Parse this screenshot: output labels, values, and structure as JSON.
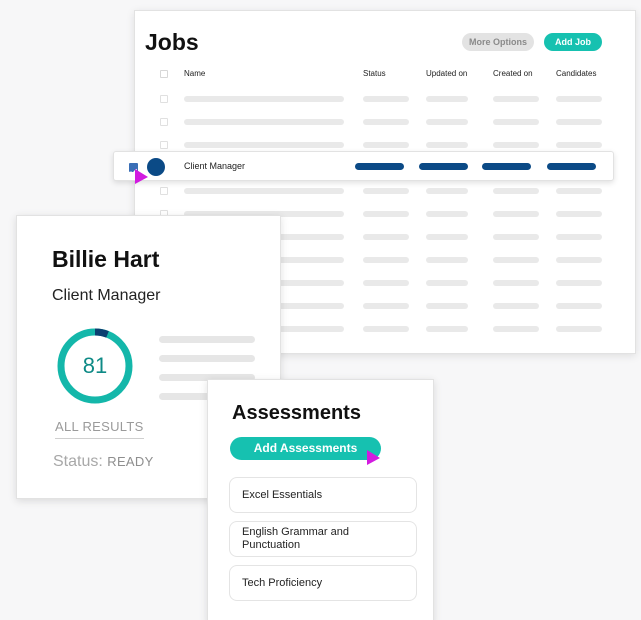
{
  "jobs": {
    "title": "Jobs",
    "more_options_label": "More Options",
    "add_job_label": "Add Job",
    "columns": [
      "Name",
      "Status",
      "Updated on",
      "Created on",
      "Candidates"
    ],
    "selected_row": {
      "name": "Client Manager"
    }
  },
  "profile": {
    "name": "Billie Hart",
    "role": "Client Manager",
    "score": "81",
    "score_fraction": 0.06,
    "all_results_label": "ALL RESULTS",
    "status_label": "Status:",
    "status_value": "READY"
  },
  "assessments": {
    "title": "Assessments",
    "add_label": "Add Assessments",
    "items": [
      "Excel Essentials",
      "English Grammar and Punctuation",
      "Tech Proficiency"
    ]
  },
  "colors": {
    "accent": "#16c1b0",
    "primary_dark": "#0b4a86",
    "cursor": "#d21be0"
  },
  "icons": [
    "checkbox-checked-icon",
    "pointer-cursor-icon"
  ]
}
